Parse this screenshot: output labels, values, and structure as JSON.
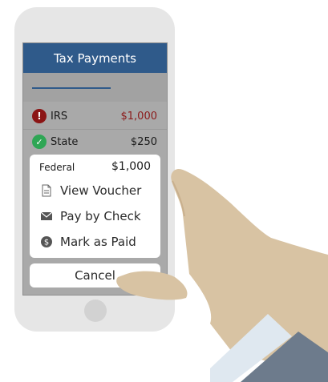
{
  "app": {
    "title": "Tax Payments"
  },
  "payments": [
    {
      "status": "overdue",
      "name": "IRS",
      "amount": "$1,000",
      "amount_color": "#8b1a1a",
      "icon": "alert-icon"
    },
    {
      "status": "paid",
      "name": "State",
      "amount": "$250",
      "amount_color": "#1a1a1a",
      "icon": "check-icon"
    }
  ],
  "action_sheet": {
    "title": "Federal",
    "amount": "$1,000",
    "actions": [
      {
        "label": "View Voucher",
        "icon": "document-icon"
      },
      {
        "label": "Pay by Check",
        "icon": "envelope-icon"
      },
      {
        "label": "Mark as Paid",
        "icon": "dollar-coin-icon"
      }
    ],
    "cancel_label": "Cancel"
  },
  "colors": {
    "header": "#2f5a8a",
    "alert": "#8b1414",
    "ok": "#2fa655",
    "skin": "#d8c3a3",
    "sleeve": "#6d7b8c",
    "cuff": "#dfe8f0"
  }
}
